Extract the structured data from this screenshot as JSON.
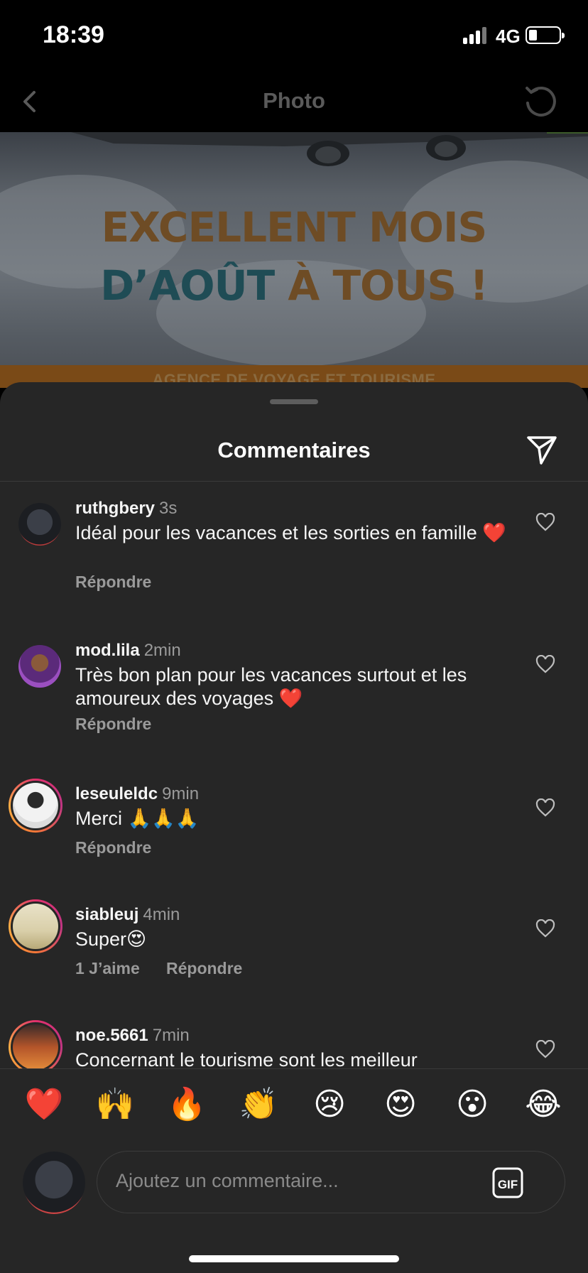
{
  "status_bar": {
    "time": "18:39",
    "network": "4G"
  },
  "nav": {
    "title": "Photo"
  },
  "photo": {
    "headline_line1": "EXCELLENT MOIS",
    "headline_line2_a": "D’AOÛT ",
    "headline_line2_b": "À TOUS !",
    "banner": "AGENCE DE VOYAGE ET TOURISME"
  },
  "sheet": {
    "title": "Commentaires"
  },
  "comments": [
    {
      "user": "ruthgbery",
      "age": "3s",
      "text": "Idéal pour les vacances et les sorties en famille ❤️",
      "reply": "Répondre"
    },
    {
      "user": "mod.lila",
      "age": "2min",
      "text": "Très bon plan pour les vacances surtout et les amoureux des voyages ❤️",
      "reply": "Répondre"
    },
    {
      "user": "leseuleldc",
      "age": "9min",
      "text": "Merci 🙏🙏🙏",
      "reply": "Répondre"
    },
    {
      "user": "siableuj",
      "age": "4min",
      "text": "Super😍",
      "likes": "1 J’aime",
      "reply": "Répondre"
    },
    {
      "user": "noe.5661",
      "age": "7min",
      "text": "Concernant le tourisme sont les meilleur"
    }
  ],
  "emoji_bar": [
    "❤️",
    "🙌",
    "🔥",
    "👏",
    "😢",
    "😍",
    "😮",
    "😂"
  ],
  "composer": {
    "placeholder": "Ajoutez un commentaire...",
    "gif_label": "GIF"
  },
  "colors": {
    "sheet_bg": "#262626",
    "accent_ring": "#e1306c",
    "muted_text": "#9a9a9a"
  },
  "icons": [
    "back-icon",
    "refresh-icon",
    "share-icon",
    "heart-icon",
    "gif-icon"
  ]
}
